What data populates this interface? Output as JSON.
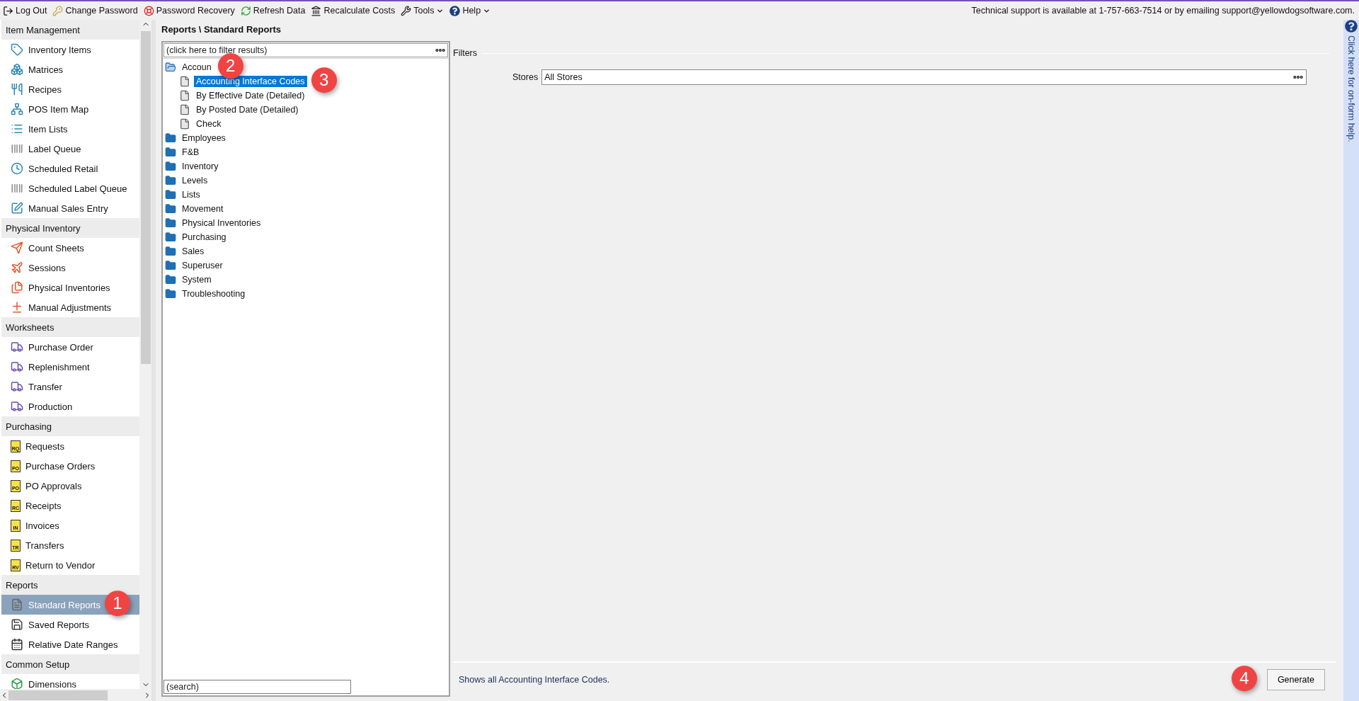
{
  "toolbar": {
    "items": [
      {
        "label": "Log Out",
        "kind": "button"
      },
      {
        "label": "Change Password",
        "kind": "button"
      },
      {
        "label": "Password Recovery",
        "kind": "button"
      },
      {
        "label": "Refresh Data",
        "kind": "button"
      },
      {
        "label": "Recalculate Costs",
        "kind": "button"
      },
      {
        "label": "Tools",
        "kind": "menu"
      },
      {
        "label": "Help",
        "kind": "menu"
      }
    ],
    "support_text": "Technical support is available at 1-757-663-7514 or by emailing support@yellowdogsoftware.com."
  },
  "sidebar": {
    "sections": [
      {
        "title": "Item Management",
        "items": [
          {
            "label": "Inventory Items",
            "selected": false
          },
          {
            "label": "Matrices",
            "selected": false
          },
          {
            "label": "Recipes",
            "selected": false
          },
          {
            "label": "POS Item Map",
            "selected": false
          },
          {
            "label": "Item Lists",
            "selected": false
          },
          {
            "label": "Label Queue",
            "selected": false
          },
          {
            "label": "Scheduled Retail",
            "selected": false
          },
          {
            "label": "Scheduled Label Queue",
            "selected": false
          },
          {
            "label": "Manual Sales Entry",
            "selected": false
          }
        ]
      },
      {
        "title": "Physical Inventory",
        "items": [
          {
            "label": "Count Sheets",
            "selected": false
          },
          {
            "label": "Sessions",
            "selected": false
          },
          {
            "label": "Physical Inventories",
            "selected": false
          },
          {
            "label": "Manual Adjustments",
            "selected": false
          }
        ]
      },
      {
        "title": "Worksheets",
        "items": [
          {
            "label": "Purchase Order",
            "selected": false
          },
          {
            "label": "Replenishment",
            "selected": false
          },
          {
            "label": "Transfer",
            "selected": false
          },
          {
            "label": "Production",
            "selected": false
          }
        ]
      },
      {
        "title": "Purchasing",
        "items": [
          {
            "label": "Requests",
            "selected": false,
            "icon_text": "RQ"
          },
          {
            "label": "Purchase Orders",
            "selected": false,
            "icon_text": "PO"
          },
          {
            "label": "PO Approvals",
            "selected": false,
            "icon_text": "PO"
          },
          {
            "label": "Receipts",
            "selected": false,
            "icon_text": "RC"
          },
          {
            "label": "Invoices",
            "selected": false,
            "icon_text": "IN"
          },
          {
            "label": "Transfers",
            "selected": false,
            "icon_text": "TR"
          },
          {
            "label": "Return to Vendor",
            "selected": false,
            "icon_text": "RV"
          }
        ]
      },
      {
        "title": "Reports",
        "items": [
          {
            "label": "Standard Reports",
            "selected": true,
            "callout": "1"
          },
          {
            "label": "Saved Reports",
            "selected": false
          },
          {
            "label": "Relative Date Ranges",
            "selected": false
          }
        ]
      },
      {
        "title": "Common Setup",
        "items": [
          {
            "label": "Dimensions",
            "selected": false
          }
        ]
      }
    ]
  },
  "breadcrumb": "Reports \\ Standard Reports",
  "tree": {
    "filter_placeholder": "(click here to filter results)",
    "search_placeholder": "(search)",
    "children": [
      {
        "label": "Accoun",
        "expanded": true,
        "callout": "2",
        "children": [
          {
            "label": "Accounting Interface Codes",
            "selected": true,
            "callout": "3"
          },
          {
            "label": "By Effective Date (Detailed)",
            "selected": false
          },
          {
            "label": "By Posted Date (Detailed)",
            "selected": false
          },
          {
            "label": "Check",
            "selected": false
          }
        ]
      },
      {
        "label": "Employees",
        "expanded": false
      },
      {
        "label": "F&B",
        "expanded": false
      },
      {
        "label": "Inventory",
        "expanded": false
      },
      {
        "label": "Levels",
        "expanded": false
      },
      {
        "label": "Lists",
        "expanded": false
      },
      {
        "label": "Movement",
        "expanded": false
      },
      {
        "label": "Physical Inventories",
        "expanded": false
      },
      {
        "label": "Purchasing",
        "expanded": false
      },
      {
        "label": "Sales",
        "expanded": false
      },
      {
        "label": "Superuser",
        "expanded": false
      },
      {
        "label": "System",
        "expanded": false
      },
      {
        "label": "Troubleshooting",
        "expanded": false
      }
    ]
  },
  "filters": {
    "title": "Filters",
    "fields": [
      {
        "label": "Stores",
        "value": "All Stores"
      }
    ]
  },
  "footer": {
    "description": "Shows all Accounting Interface Codes.",
    "button": "Generate",
    "callout": "4"
  },
  "help_strip": {
    "label": "Click here for on-form help."
  }
}
